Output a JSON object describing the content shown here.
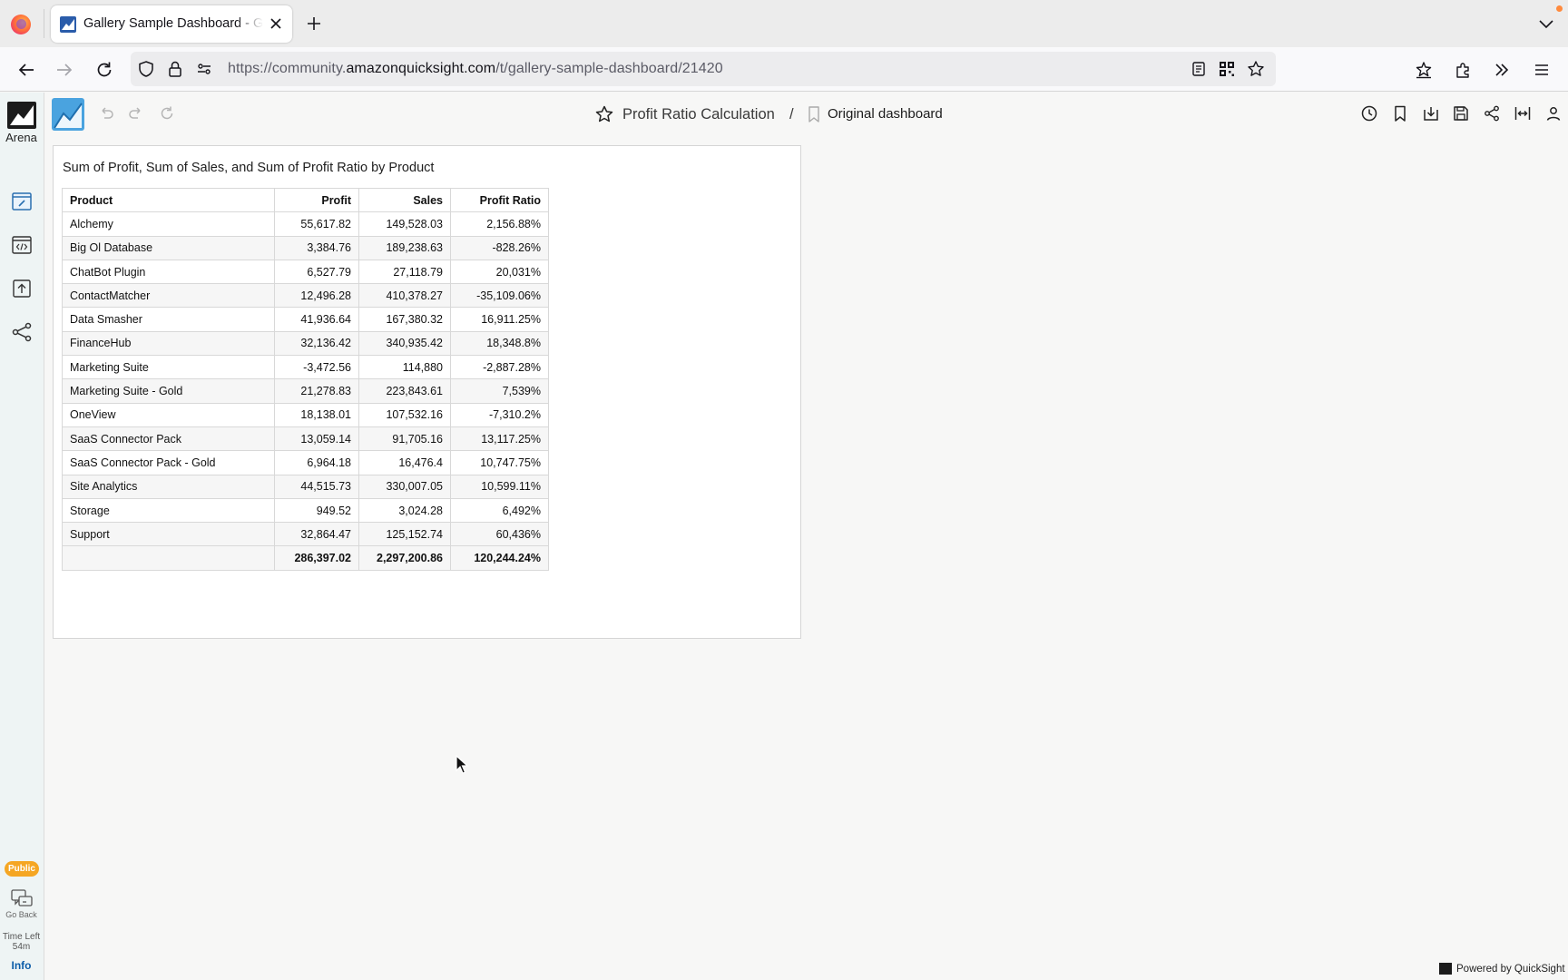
{
  "browser": {
    "tab_title": "Gallery Sample Dashboard - Gallery Sample Dashboard",
    "url_prefix": "https://community.",
    "url_domain": "amazonquicksight.com",
    "url_path": "/t/gallery-sample-dashboard/21420"
  },
  "rail": {
    "app_name": "Arena",
    "public_badge": "Public",
    "go_back": "Go Back",
    "time_left_label": "Time Left",
    "time_left_value": "54m",
    "info": "Info"
  },
  "header": {
    "analysis_name": "Profit Ratio Calculation",
    "separator": "/",
    "dashboard_name": "Original dashboard"
  },
  "visual": {
    "title": "Sum of Profit, Sum of Sales, and Sum of Profit Ratio by Product",
    "columns": [
      "Product",
      "Profit",
      "Sales",
      "Profit Ratio"
    ],
    "rows": [
      [
        "Alchemy",
        "55,617.82",
        "149,528.03",
        "2,156.88%"
      ],
      [
        "Big Ol Database",
        "3,384.76",
        "189,238.63",
        "-828.26%"
      ],
      [
        "ChatBot Plugin",
        "6,527.79",
        "27,118.79",
        "20,031%"
      ],
      [
        "ContactMatcher",
        "12,496.28",
        "410,378.27",
        "-35,109.06%"
      ],
      [
        "Data Smasher",
        "41,936.64",
        "167,380.32",
        "16,911.25%"
      ],
      [
        "FinanceHub",
        "32,136.42",
        "340,935.42",
        "18,348.8%"
      ],
      [
        "Marketing Suite",
        "-3,472.56",
        "114,880",
        "-2,887.28%"
      ],
      [
        "Marketing Suite - Gold",
        "21,278.83",
        "223,843.61",
        "7,539%"
      ],
      [
        "OneView",
        "18,138.01",
        "107,532.16",
        "-7,310.2%"
      ],
      [
        "SaaS Connector Pack",
        "13,059.14",
        "91,705.16",
        "13,117.25%"
      ],
      [
        "SaaS Connector Pack - Gold",
        "6,964.18",
        "16,476.4",
        "10,747.75%"
      ],
      [
        "Site Analytics",
        "44,515.73",
        "330,007.05",
        "10,599.11%"
      ],
      [
        "Storage",
        "949.52",
        "3,024.28",
        "6,492%"
      ],
      [
        "Support",
        "32,864.47",
        "125,152.74",
        "60,436%"
      ]
    ],
    "totals": [
      "",
      "286,397.02",
      "2,297,200.86",
      "120,244.24%"
    ]
  },
  "footer": {
    "powered_by": "Powered by QuickSight"
  },
  "colors": {
    "brand_tile": "#4aa3df",
    "public_badge": "#f5a623",
    "info_link": "#0b5ca8"
  },
  "icons": {
    "tab_bar": [
      "firefox-logo",
      "quicksight-favicon",
      "close-icon",
      "plus-icon",
      "chevron-down-icon"
    ],
    "nav": [
      "back-arrow-icon",
      "forward-arrow-icon",
      "reload-icon",
      "shield-icon",
      "lock-icon",
      "permissions-icon",
      "reader-view-icon",
      "qr-code-icon",
      "star-icon",
      "pocket-icon",
      "extensions-icon",
      "overflow-icon",
      "hamburger-menu-icon"
    ],
    "rail": [
      "quicksight-logo",
      "edit-dashboard-icon",
      "embed-code-icon",
      "upload-icon",
      "share-icon",
      "go-back-chat-icon"
    ],
    "header": [
      "undo-icon",
      "redo-icon",
      "reset-icon",
      "favorite-star-icon",
      "bookmark-icon",
      "history-clock-icon",
      "bookmarks-icon",
      "download-icon",
      "save-icon",
      "share-icon",
      "fit-width-icon",
      "user-icon"
    ]
  }
}
